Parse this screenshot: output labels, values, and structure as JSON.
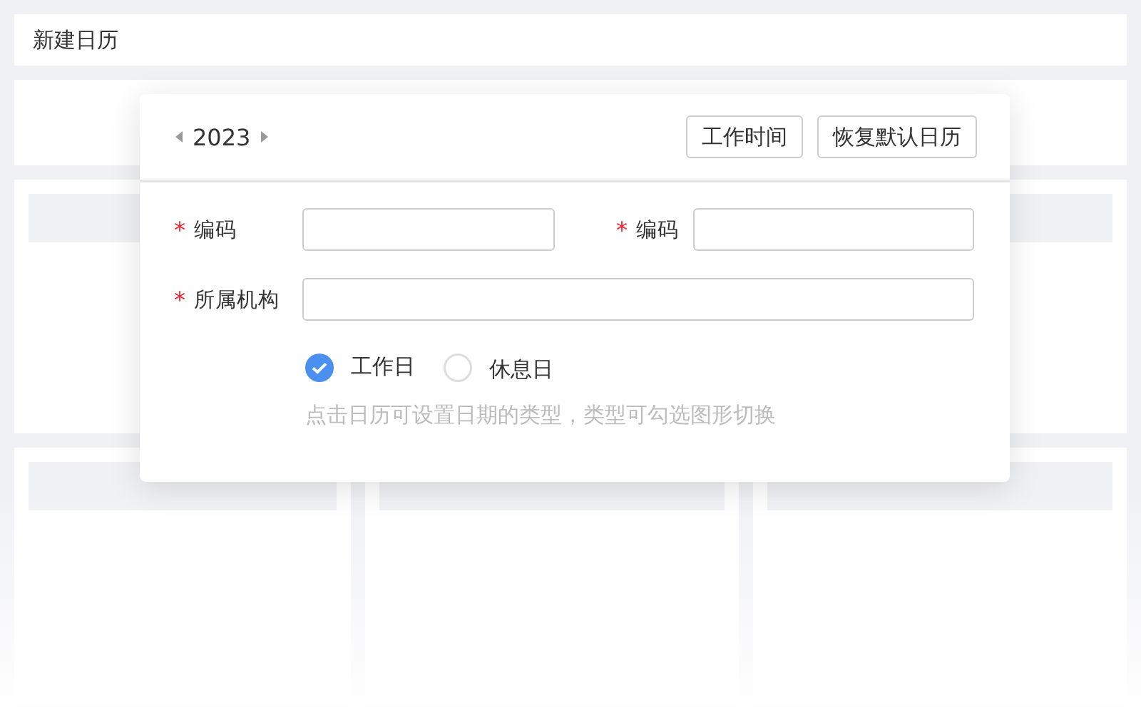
{
  "page": {
    "title": "新建日历"
  },
  "dialog": {
    "year": "2023",
    "buttons": [
      "工作时间",
      "恢复默认日历"
    ],
    "fields": [
      {
        "label": "编码",
        "mark": "*",
        "wide": false
      },
      {
        "label": "编码",
        "mark": "*",
        "wide": false
      },
      {
        "label": "所属机构",
        "mark": "*",
        "wide": true
      }
    ],
    "day_types": [
      {
        "label": "工作日",
        "selected": true
      },
      {
        "label": "休息日",
        "selected": false
      }
    ],
    "hint": "点击日历可设置日期的类型，类型可勾选图形切换"
  }
}
